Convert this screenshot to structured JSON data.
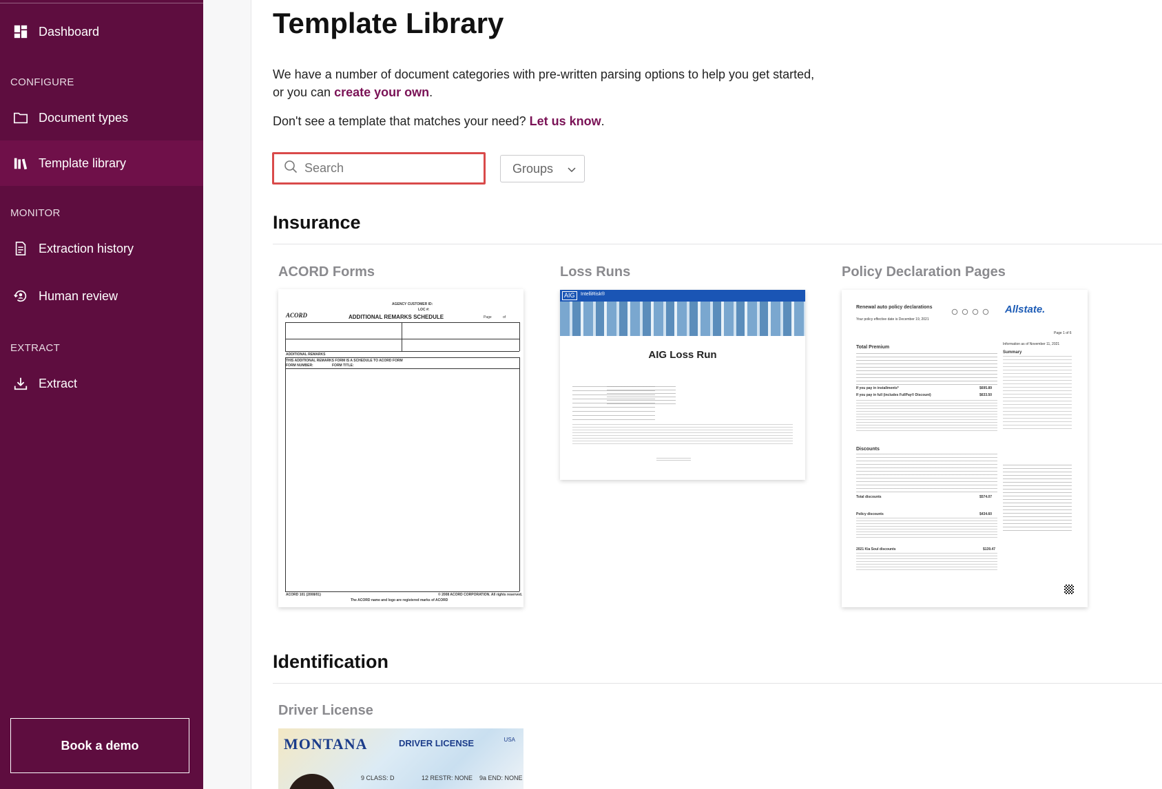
{
  "sidebar": {
    "items": [
      {
        "label": "Dashboard",
        "icon": "dashboard-icon"
      },
      {
        "label": "Document types",
        "icon": "folder-icon"
      },
      {
        "label": "Template library",
        "icon": "library-icon",
        "active": true
      },
      {
        "label": "Extraction history",
        "icon": "history-document-icon"
      },
      {
        "label": "Human review",
        "icon": "human-review-icon"
      },
      {
        "label": "Extract",
        "icon": "download-icon"
      }
    ],
    "sections": {
      "configure": "CONFIGURE",
      "monitor": "MONITOR",
      "extract": "EXTRACT"
    },
    "book_demo": "Book a demo",
    "colors": {
      "background": "#5e0d3f",
      "active": "#6f1049"
    }
  },
  "main": {
    "title": "Template Library",
    "intro_text": "We have a number of document categories with pre-written parsing options to help you get started,",
    "intro_text2": "or you can ",
    "intro_link": "create your own",
    "intro_end": ".",
    "hint_text": "Don't see a template that matches your need? ",
    "hint_link": "Let us know",
    "hint_end": ".",
    "search_placeholder": "Search",
    "groups_label": "Groups",
    "link_color": "#7a1256"
  },
  "sections": [
    {
      "title": "Insurance",
      "cards": [
        {
          "title": "ACORD Forms"
        },
        {
          "title": "Loss Runs"
        },
        {
          "title": "Policy Declaration Pages"
        }
      ]
    },
    {
      "title": "Identification",
      "cards": [
        {
          "title": "Driver License"
        }
      ]
    }
  ],
  "thumbs": {
    "acord": {
      "logo": "ACORD",
      "heading": "ADDITIONAL REMARKS SCHEDULE",
      "agency": "AGENCY CUSTOMER ID:",
      "loc": "LOC #:",
      "page": "Page",
      "of": "of",
      "remarks": "ADDITIONAL REMARKS",
      "schedule_note": "THIS ADDITIONAL REMARKS FORM IS A SCHEDULE TO ACORD FORM",
      "form_number": "FORM NUMBER:",
      "form_title": "FORM TITLE:",
      "footer_left": "ACORD 101 (2008/01)",
      "footer_right": "© 2008 ACORD CORPORATION. All rights reserved.",
      "footer_center": "The ACORD name and logo are registered marks of ACORD"
    },
    "aig": {
      "brand": "AIG",
      "product": "IntelliRisk®",
      "title": "AIG Loss Run"
    },
    "allstate": {
      "heading": "Renewal auto policy declarations",
      "effective": "Your policy effective date is December 19, 2021",
      "page": "Page 1 of 6",
      "info": "Information as of November 11, 2021",
      "logo": "Allstate.",
      "total_premium": "Total Premium",
      "summary": "Summary",
      "installments": "If you pay in installments*",
      "installments_value": "$695.89",
      "full": "If you pay in full (includes FullPay® Discount)",
      "full_value": "$633.50",
      "discounts": "Discounts",
      "total_discounts": "Total discounts",
      "total_discounts_value": "$574.07",
      "policy_discounts": "Policy discounts",
      "policy_discounts_value": "$434.60",
      "kia_discounts": "2021 Kia Soul discounts",
      "kia_discounts_value": "$139.47"
    },
    "license": {
      "state": "MONTANA",
      "title": "DRIVER LICENSE",
      "country": "USA",
      "class": "9  CLASS: D",
      "restr": "12 RESTR: NONE",
      "end": "9a END: NONE"
    }
  }
}
